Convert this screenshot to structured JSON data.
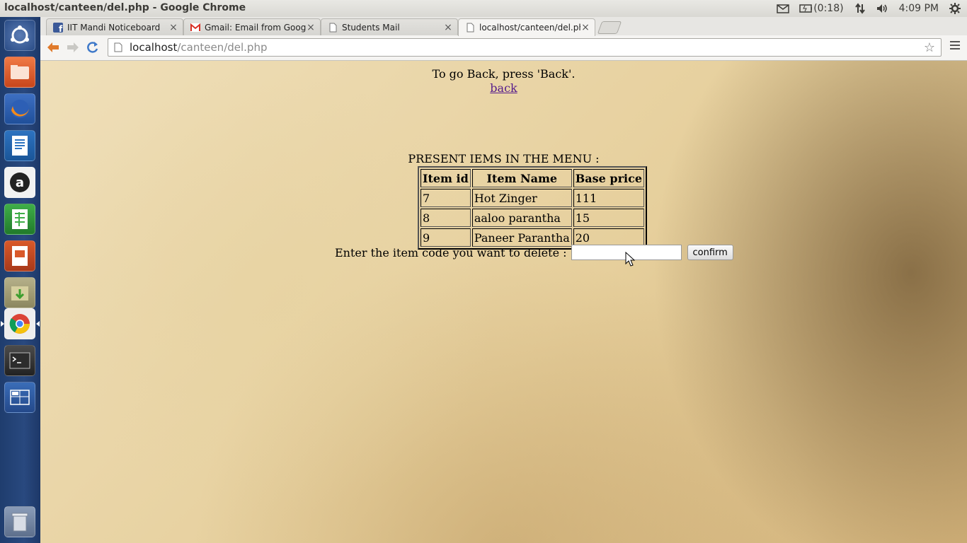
{
  "window": {
    "title": "localhost/canteen/del.php - Google Chrome"
  },
  "tray": {
    "battery_text": "(0:18)",
    "clock": "4:09 PM"
  },
  "launcher": {
    "items": [
      {
        "name": "dash-icon"
      },
      {
        "name": "files-icon"
      },
      {
        "name": "firefox-icon"
      },
      {
        "name": "writer-icon"
      },
      {
        "name": "amazon-icon"
      },
      {
        "name": "calc-icon"
      },
      {
        "name": "impress-icon"
      },
      {
        "name": "archive-icon"
      },
      {
        "name": "chrome-icon"
      },
      {
        "name": "terminal-icon"
      },
      {
        "name": "workspace-icon"
      },
      {
        "name": "trash-icon"
      }
    ]
  },
  "tabs": [
    {
      "label": "IIT Mandi Noticeboard",
      "icon": "facebook-icon",
      "close": "×"
    },
    {
      "label": "Gmail: Email from Google",
      "icon": "gmail-icon",
      "close": "×"
    },
    {
      "label": "Students Mail",
      "icon": "page-icon",
      "close": "×"
    },
    {
      "label": "localhost/canteen/del.php",
      "icon": "page-icon",
      "close": "×"
    }
  ],
  "omnibox": {
    "host": "localhost",
    "path": "/canteen/del.php"
  },
  "page": {
    "back_instruction": "To go Back, press 'Back'.",
    "back_link": "back",
    "menu_heading": "PRESENT IEMS IN THE MENU :",
    "table": {
      "headers": [
        "Item id",
        "Item Name",
        "Base price"
      ],
      "rows": [
        [
          "7",
          "Hot Zinger",
          "111"
        ],
        [
          "8",
          "aaloo parantha",
          "15"
        ],
        [
          "9",
          "Paneer Parantha",
          "20"
        ]
      ]
    },
    "delete_prompt": "Enter the item code you want to delete :",
    "delete_input_value": "",
    "confirm_label": "confirm"
  }
}
